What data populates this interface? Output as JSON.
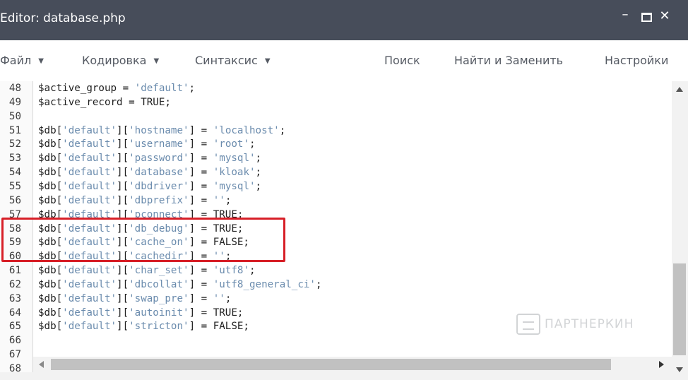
{
  "window": {
    "title": "Editor: database.php",
    "minimize_icon": "minimize-icon",
    "maximize_icon": "maximize-icon",
    "close_icon": "close-icon",
    "minimize_label": "–",
    "close_label": "✕"
  },
  "menu": {
    "file": "Файл",
    "encoding": "Кодировка",
    "syntax": "Синтаксис",
    "search": "Поиск",
    "find_replace": "Найти и Заменить",
    "settings": "Настройки"
  },
  "code_lines": [
    {
      "num": "48",
      "parts": [
        [
          "$active_group = ",
          ""
        ],
        [
          "'default'",
          "str"
        ],
        [
          ";",
          ""
        ]
      ]
    },
    {
      "num": "49",
      "parts": [
        [
          "$active_record = TRUE;",
          ""
        ]
      ]
    },
    {
      "num": "50",
      "parts": []
    },
    {
      "num": "51",
      "parts": [
        [
          "$db[",
          ""
        ],
        [
          "'default'",
          "str"
        ],
        [
          "][",
          ""
        ],
        [
          "'hostname'",
          "str"
        ],
        [
          "] = ",
          ""
        ],
        [
          "'localhost'",
          "str"
        ],
        [
          ";",
          ""
        ]
      ]
    },
    {
      "num": "52",
      "parts": [
        [
          "$db[",
          ""
        ],
        [
          "'default'",
          "str"
        ],
        [
          "][",
          ""
        ],
        [
          "'username'",
          "str"
        ],
        [
          "] = ",
          ""
        ],
        [
          "'root'",
          "str"
        ],
        [
          ";",
          ""
        ]
      ]
    },
    {
      "num": "53",
      "parts": [
        [
          "$db[",
          ""
        ],
        [
          "'default'",
          "str"
        ],
        [
          "][",
          ""
        ],
        [
          "'password'",
          "str"
        ],
        [
          "] = ",
          ""
        ],
        [
          "'mysql'",
          "str"
        ],
        [
          ";",
          ""
        ]
      ]
    },
    {
      "num": "54",
      "parts": [
        [
          "$db[",
          ""
        ],
        [
          "'default'",
          "str"
        ],
        [
          "][",
          ""
        ],
        [
          "'database'",
          "str"
        ],
        [
          "] = ",
          ""
        ],
        [
          "'kloak'",
          "str"
        ],
        [
          ";",
          ""
        ]
      ]
    },
    {
      "num": "55",
      "parts": [
        [
          "$db[",
          ""
        ],
        [
          "'default'",
          "str"
        ],
        [
          "][",
          ""
        ],
        [
          "'dbdriver'",
          "str"
        ],
        [
          "] = ",
          ""
        ],
        [
          "'mysql'",
          "str"
        ],
        [
          ";",
          ""
        ]
      ]
    },
    {
      "num": "56",
      "parts": [
        [
          "$db[",
          ""
        ],
        [
          "'default'",
          "str"
        ],
        [
          "][",
          ""
        ],
        [
          "'dbprefix'",
          "str"
        ],
        [
          "] = ",
          ""
        ],
        [
          "''",
          "str"
        ],
        [
          ";",
          ""
        ]
      ]
    },
    {
      "num": "57",
      "parts": [
        [
          "$db[",
          ""
        ],
        [
          "'default'",
          "str"
        ],
        [
          "][",
          ""
        ],
        [
          "'pconnect'",
          "str"
        ],
        [
          "] = TRUE;",
          ""
        ]
      ]
    },
    {
      "num": "58",
      "parts": [
        [
          "$db[",
          ""
        ],
        [
          "'default'",
          "str"
        ],
        [
          "][",
          ""
        ],
        [
          "'db_debug'",
          "str"
        ],
        [
          "] = TRUE;",
          ""
        ]
      ]
    },
    {
      "num": "59",
      "parts": [
        [
          "$db[",
          ""
        ],
        [
          "'default'",
          "str"
        ],
        [
          "][",
          ""
        ],
        [
          "'cache_on'",
          "str"
        ],
        [
          "] = FALSE;",
          ""
        ]
      ]
    },
    {
      "num": "60",
      "parts": [
        [
          "$db[",
          ""
        ],
        [
          "'default'",
          "str"
        ],
        [
          "][",
          ""
        ],
        [
          "'cachedir'",
          "str"
        ],
        [
          "] = ",
          ""
        ],
        [
          "''",
          "str"
        ],
        [
          ";",
          ""
        ]
      ]
    },
    {
      "num": "61",
      "parts": [
        [
          "$db[",
          ""
        ],
        [
          "'default'",
          "str"
        ],
        [
          "][",
          ""
        ],
        [
          "'char_set'",
          "str"
        ],
        [
          "] = ",
          ""
        ],
        [
          "'utf8'",
          "str"
        ],
        [
          ";",
          ""
        ]
      ]
    },
    {
      "num": "62",
      "parts": [
        [
          "$db[",
          ""
        ],
        [
          "'default'",
          "str"
        ],
        [
          "][",
          ""
        ],
        [
          "'dbcollat'",
          "str"
        ],
        [
          "] = ",
          ""
        ],
        [
          "'utf8_general_ci'",
          "str"
        ],
        [
          ";",
          ""
        ]
      ]
    },
    {
      "num": "63",
      "parts": [
        [
          "$db[",
          ""
        ],
        [
          "'default'",
          "str"
        ],
        [
          "][",
          ""
        ],
        [
          "'swap_pre'",
          "str"
        ],
        [
          "] = ",
          ""
        ],
        [
          "''",
          "str"
        ],
        [
          ";",
          ""
        ]
      ]
    },
    {
      "num": "64",
      "parts": [
        [
          "$db[",
          ""
        ],
        [
          "'default'",
          "str"
        ],
        [
          "][",
          ""
        ],
        [
          "'autoinit'",
          "str"
        ],
        [
          "] = TRUE;",
          ""
        ]
      ]
    },
    {
      "num": "65",
      "parts": [
        [
          "$db[",
          ""
        ],
        [
          "'default'",
          "str"
        ],
        [
          "][",
          ""
        ],
        [
          "'stricton'",
          "str"
        ],
        [
          "] = FALSE;",
          ""
        ]
      ]
    },
    {
      "num": "66",
      "parts": []
    },
    {
      "num": "67",
      "parts": []
    },
    {
      "num": "68",
      "parts": []
    }
  ],
  "watermark": {
    "text": "ПАРТНЕРКИН"
  },
  "colors": {
    "titlebar": "#474d5a",
    "highlight": "#d71f27",
    "string": "#6a8bad"
  }
}
